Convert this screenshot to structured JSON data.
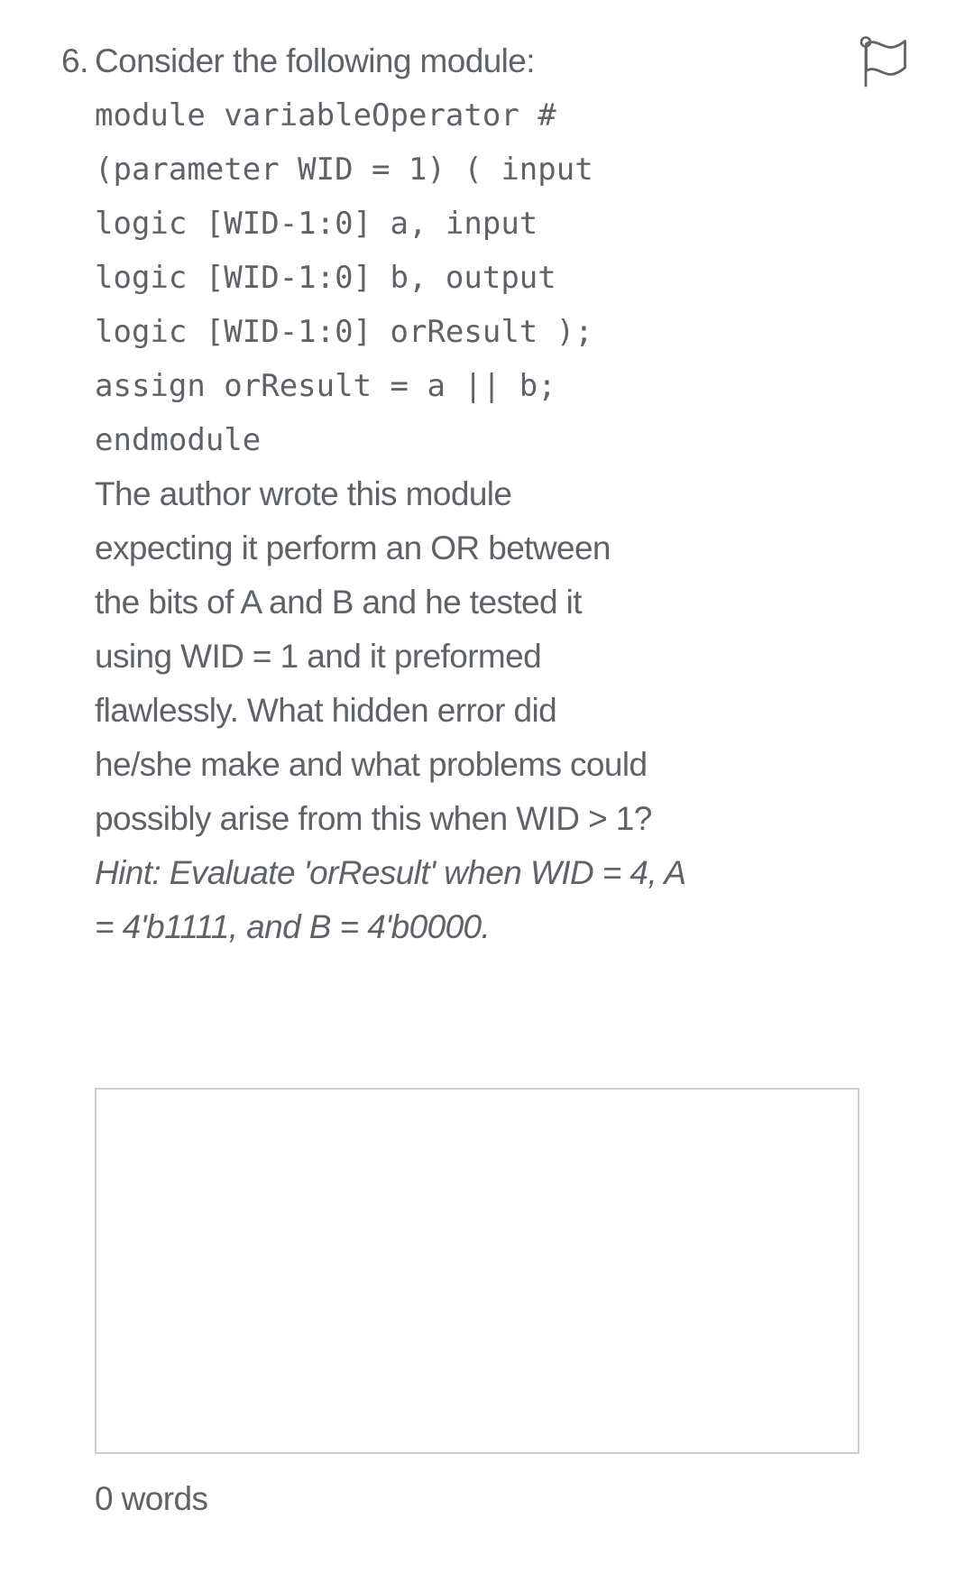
{
  "question": {
    "number": "6.",
    "intro": "Consider the following module:",
    "code": "module variableOperator # (parameter WID = 1) ( input logic [WID-1:0] a, input logic [WID-1:0] b, output logic [WID-1:0] orResult ); assign orResult = a || b; endmodule",
    "code_lines": [
      "module variableOperator #",
      "(parameter WID = 1) ( input",
      "logic [WID-1:0] a, input",
      "logic [WID-1:0] b, output",
      "logic [WID-1:0] orResult );",
      "assign orResult = a || b;",
      "endmodule"
    ],
    "body": "The author wrote this module expecting it perform an OR between the bits of A and B and he tested it using WID = 1 and it preformed flawlessly. What hidden error did he/she make and what problems could possibly arise from this when WID > 1?",
    "body_lines": [
      "The author wrote this module",
      "expecting it perform an OR between",
      "the bits of A and B and he tested it",
      "using WID = 1 and it preformed",
      "flawlessly. What hidden error did",
      "he/she make and what problems could",
      "possibly arise from this when WID > 1?"
    ],
    "hint": "Hint: Evaluate 'orResult' when WID = 4, A = 4'b1111, and B = 4'b0000.",
    "hint_lines": [
      "Hint: Evaluate 'orResult' when WID = 4, A",
      "= 4'b1111, and B = 4'b0000."
    ]
  },
  "answer": {
    "value": "",
    "placeholder": "",
    "word_count": "0 words"
  },
  "toolbar": {
    "flag_icon": "flag-icon"
  },
  "colors": {
    "text": "#5f6368",
    "border": "#cccccc",
    "background": "#ffffff"
  }
}
